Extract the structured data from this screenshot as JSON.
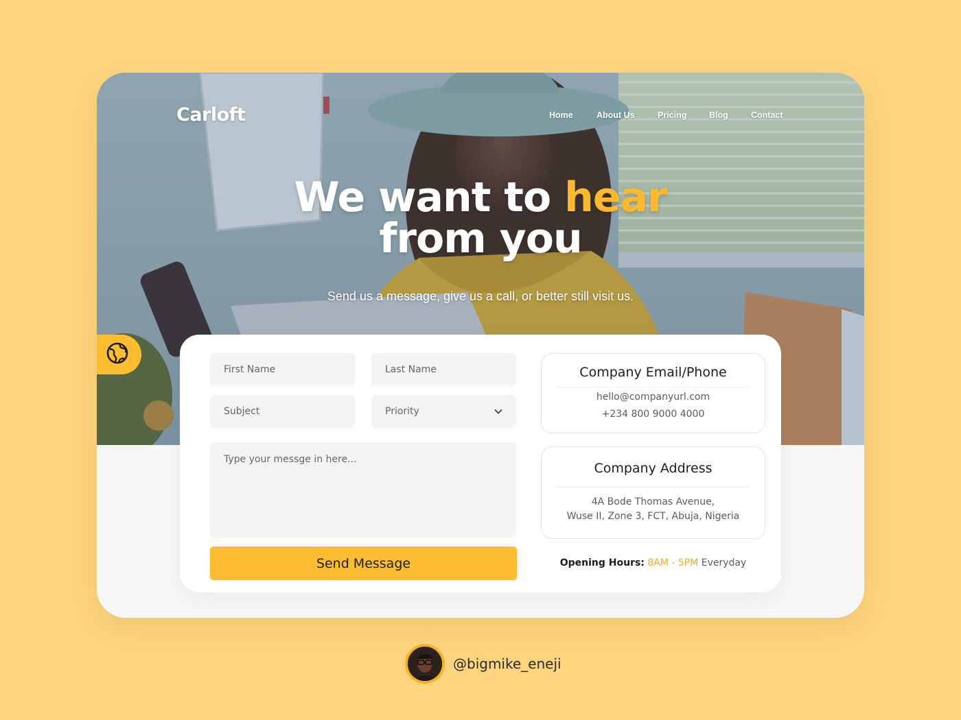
{
  "brand": {
    "logo": "Carloft"
  },
  "nav": {
    "items": [
      {
        "label": "Home"
      },
      {
        "label": "About Us"
      },
      {
        "label": "Pricing"
      },
      {
        "label": "Blog"
      },
      {
        "label": "Contact"
      }
    ]
  },
  "hero": {
    "title_part1": "We want to ",
    "title_accent": "hear",
    "title_part2": "from you",
    "subtitle": "Send us a message, give us a call, or better still visit us."
  },
  "form": {
    "first_name_placeholder": "First Name",
    "last_name_placeholder": "Last Name",
    "subject_placeholder": "Subject",
    "priority_label": "Priority",
    "message_placeholder": "Type your messge in here...",
    "send_label": "Send Message"
  },
  "contact": {
    "email_phone_title": "Company Email/Phone",
    "email": "hello@companyurl.com",
    "phone": "+234 800 9000 4000",
    "address_title": "Company Address",
    "address_line1": "4A Bode Thomas Avenue,",
    "address_line2": "Wuse II, Zone 3, FCT, Abuja, Nigeria"
  },
  "hours": {
    "label": "Opening Hours:",
    "open": "8AM",
    "separator": " - ",
    "close": "5PM",
    "days": "Everyday"
  },
  "credit": {
    "handle": "@bigmike_eneji"
  },
  "icons": {
    "side_tab": "globe-icon",
    "dropdown": "chevron-down-icon"
  },
  "colors": {
    "accent": "#fdbd30",
    "background": "#fed57e",
    "accent_text": "#f2ab1b"
  }
}
